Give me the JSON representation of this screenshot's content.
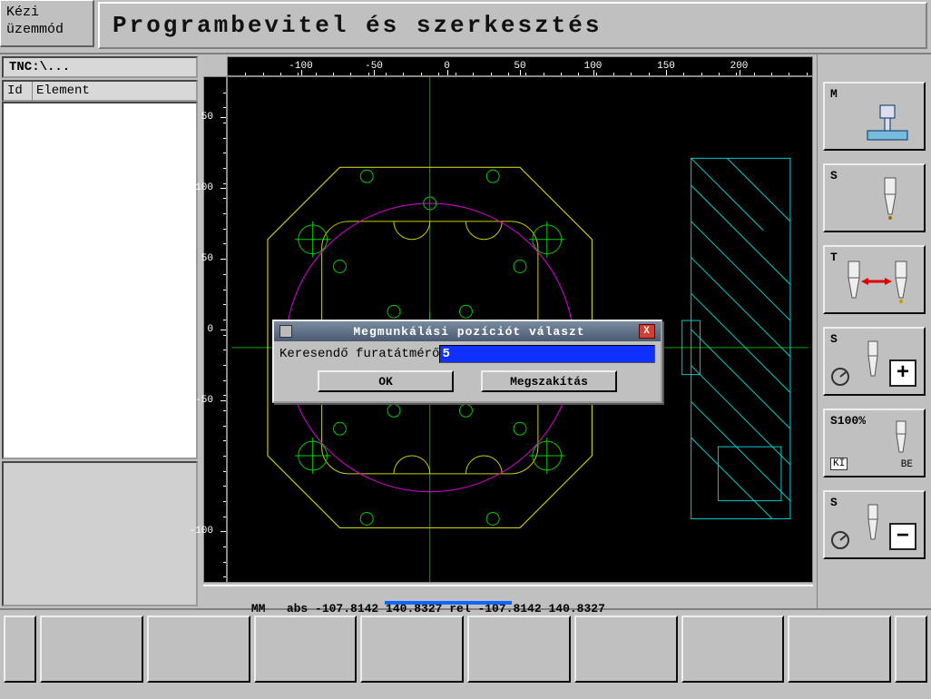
{
  "header": {
    "mode_line1": "Kézi",
    "mode_line2": "üzemmód",
    "title": "Programbevitel és szerkesztés"
  },
  "left": {
    "path": "TNC:\\...",
    "col_id": "Id",
    "col_element": "Element"
  },
  "ruler": {
    "top": [
      "-100",
      "-50",
      "0",
      "50",
      "100",
      "150",
      "200"
    ],
    "left_top_to_bottom": [
      "50",
      "100",
      "50",
      "0",
      "-50",
      "-100"
    ],
    "top_positions_pct": [
      12.5,
      25,
      37.5,
      50,
      62.5,
      75,
      87.5
    ],
    "left_positions_pct": [
      8,
      22,
      36,
      50,
      64,
      90
    ]
  },
  "status": {
    "text": "MM   abs -107.8142 140.8327 rel -107.8142 140.8327"
  },
  "right": [
    {
      "label": "M"
    },
    {
      "label": "S"
    },
    {
      "label": "T"
    },
    {
      "label": "S"
    },
    {
      "label": "S100%",
      "ki": "KI",
      "be": "BE"
    },
    {
      "label": "S"
    }
  ],
  "dialog": {
    "title": "Megmunkálási pozíciót választ",
    "field_label": "Keresendő furatátmérő",
    "field_value": "5",
    "ok": "OK",
    "cancel": "Megszakítás",
    "close": "X"
  }
}
